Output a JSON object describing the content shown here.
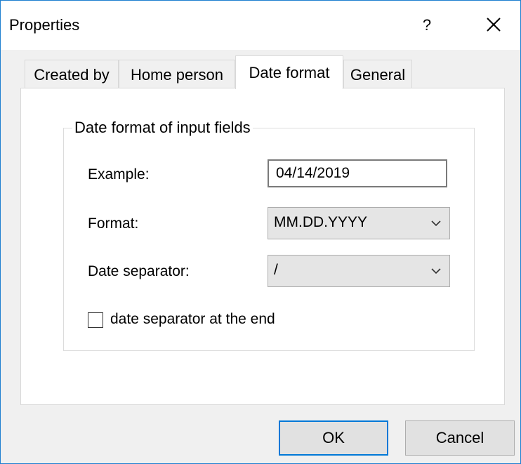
{
  "window": {
    "title": "Properties"
  },
  "titlebar": {
    "help_label": "?"
  },
  "tabs": [
    {
      "label": "Created by",
      "active": false
    },
    {
      "label": "Home person",
      "active": false
    },
    {
      "label": "Date format",
      "active": true
    },
    {
      "label": "General",
      "active": false
    }
  ],
  "group": {
    "title": "Date format of input fields",
    "example": {
      "label": "Example:",
      "value": "04/14/2019"
    },
    "format": {
      "label": "Format:",
      "value": "MM.DD.YYYY"
    },
    "separator": {
      "label": "Date separator:",
      "value": "/"
    },
    "separator_end": {
      "label": "date separator at the end",
      "checked": false
    }
  },
  "buttons": {
    "ok": "OK",
    "cancel": "Cancel"
  },
  "colors": {
    "accent": "#0078d7",
    "window_border": "#1e7fd0"
  }
}
